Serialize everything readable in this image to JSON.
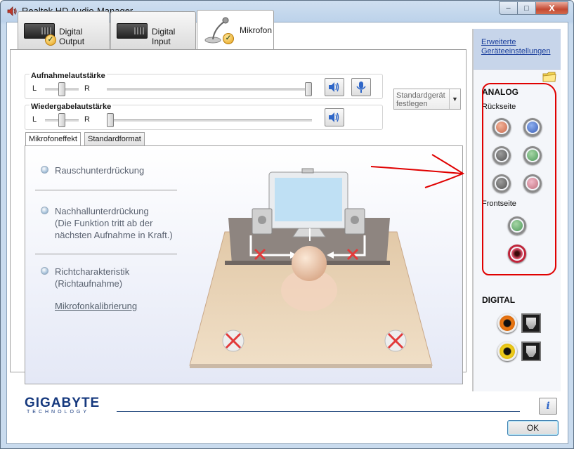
{
  "window": {
    "title": "Realtek HD Audio-Manager",
    "close_glyph": "X",
    "minimize_glyph": "–",
    "maximize_glyph": "□"
  },
  "device_tabs": [
    {
      "label": "Digital Output",
      "active": false
    },
    {
      "label": "Digital Input",
      "active": false
    },
    {
      "label": "Mikrofon",
      "active": true
    }
  ],
  "recording_volume": {
    "title": "Aufnahmelautstärke",
    "left_label": "L",
    "right_label": "R",
    "balance": 0.5,
    "level": 1.0
  },
  "playback_volume": {
    "title": "Wiedergabelautstärke",
    "left_label": "L",
    "right_label": "R",
    "balance": 0.5,
    "level": 0.0
  },
  "default_device": {
    "line1": "Standardgerät",
    "line2": "festlegen"
  },
  "inner_tabs": [
    {
      "label": "Mikrofoneffekt",
      "active": true
    },
    {
      "label": "Standardformat",
      "active": false
    }
  ],
  "effects": {
    "noise": {
      "label": "Rauschunterdrückung"
    },
    "reverb": {
      "line1": "Nachhallunterdrückung",
      "line2": "(Die Funktion tritt ab der",
      "line3": "nächsten Aufnahme in Kraft.)"
    },
    "beam": {
      "line1": "Richtcharakteristik",
      "line2": "(Richtaufnahme)"
    },
    "calibration_link": "Mikrofonkalibrierung"
  },
  "right_panel": {
    "advanced_link_line1": "Erweiterte",
    "advanced_link_line2": "Geräteeinstellungen",
    "analog_title": "ANALOG",
    "back_label": "Rückseite",
    "front_label": "Frontseite",
    "digital_title": "DIGITAL",
    "back_jacks": [
      "orange",
      "blue",
      "gray",
      "green",
      "gray",
      "pink"
    ],
    "front_jacks": [
      "green",
      "red"
    ]
  },
  "branding": {
    "name": "GIGABYTE",
    "sub": "TECHNOLOGY"
  },
  "buttons": {
    "ok": "OK",
    "info_glyph": "i"
  },
  "colors": {
    "accent": "#16397e",
    "annotation": "#e00000",
    "link": "#1b3f9c"
  }
}
